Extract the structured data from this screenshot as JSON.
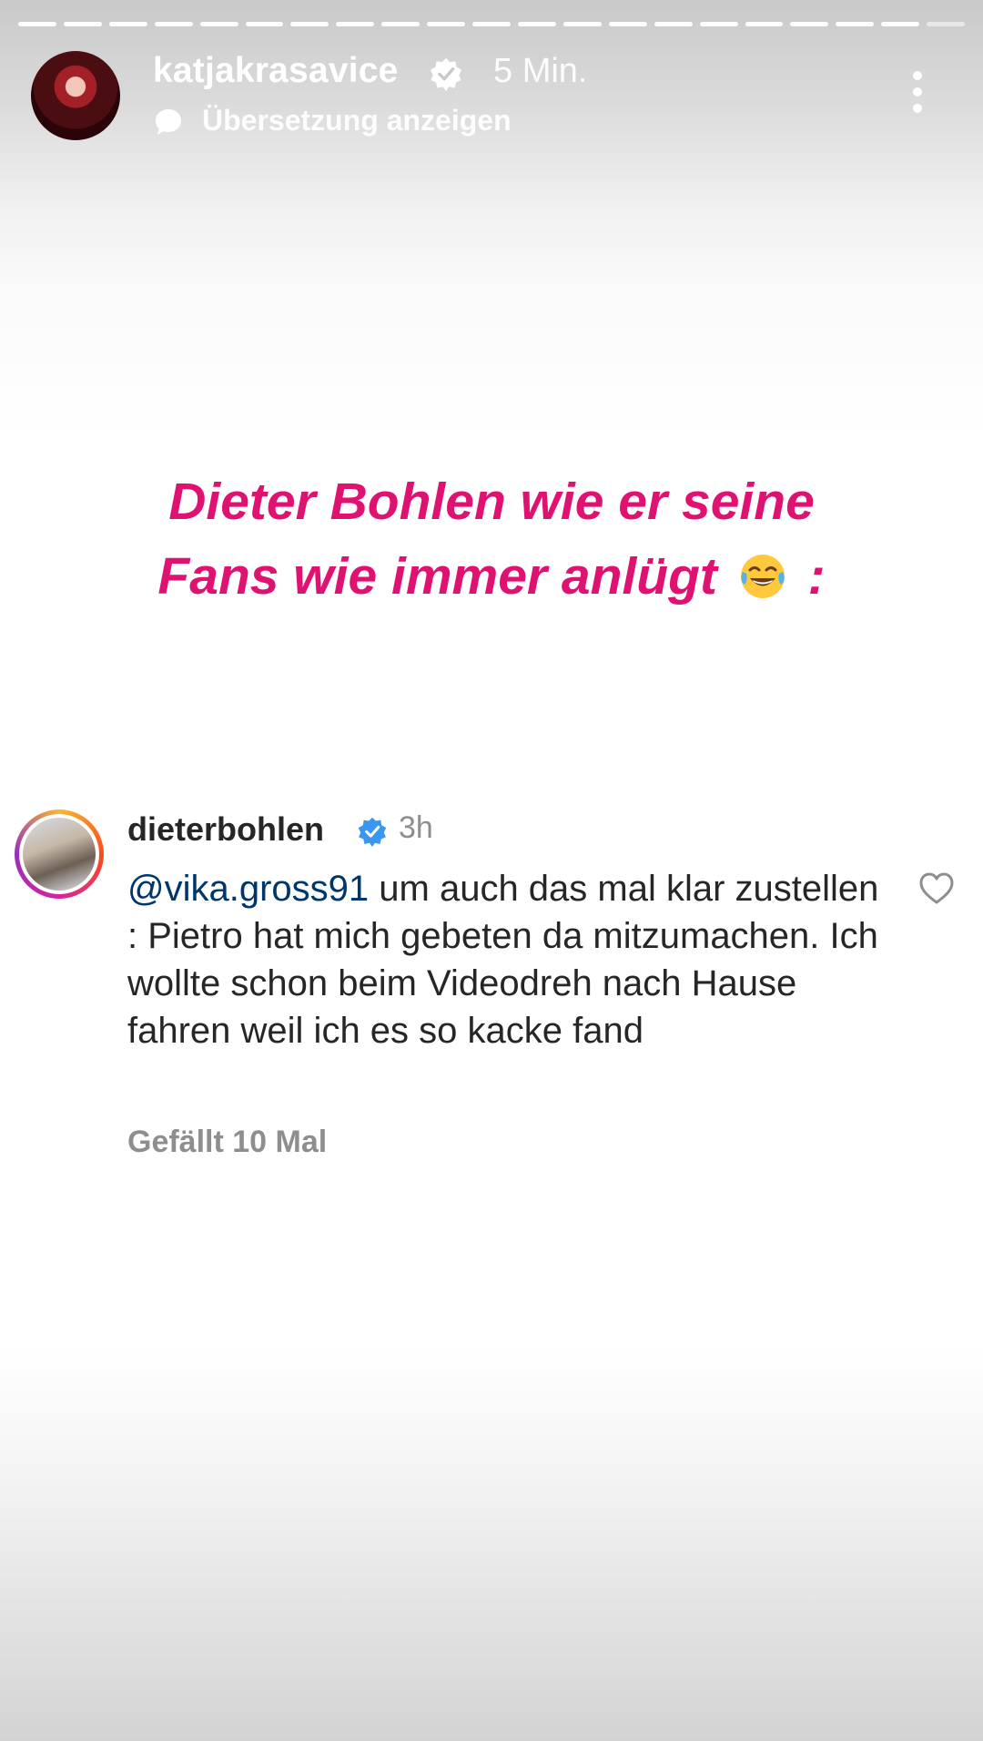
{
  "story_header": {
    "username": "katjakrasavice",
    "time": "5 Min.",
    "translate_label": "Übersetzung anzeigen"
  },
  "headline": {
    "line1": "Dieter Bohlen wie er seine",
    "line2": "Fans wie immer anlügt",
    "suffix": ":",
    "emoji": "face-with-tears-of-joy-icon"
  },
  "comment": {
    "username": "dieterbohlen",
    "time": "3h",
    "mention": "@vika.gross91",
    "text": " um auch das mal klar zustellen : Pietro hat mich gebeten da mitzumachen. Ich wollte schon beim Videodreh nach Hause fahren weil ich es so kacke fand",
    "likes": "Gefällt 10 Mal"
  },
  "colors": {
    "headline": "#e01271",
    "mention": "#00376b",
    "verified": "#3897f0"
  }
}
